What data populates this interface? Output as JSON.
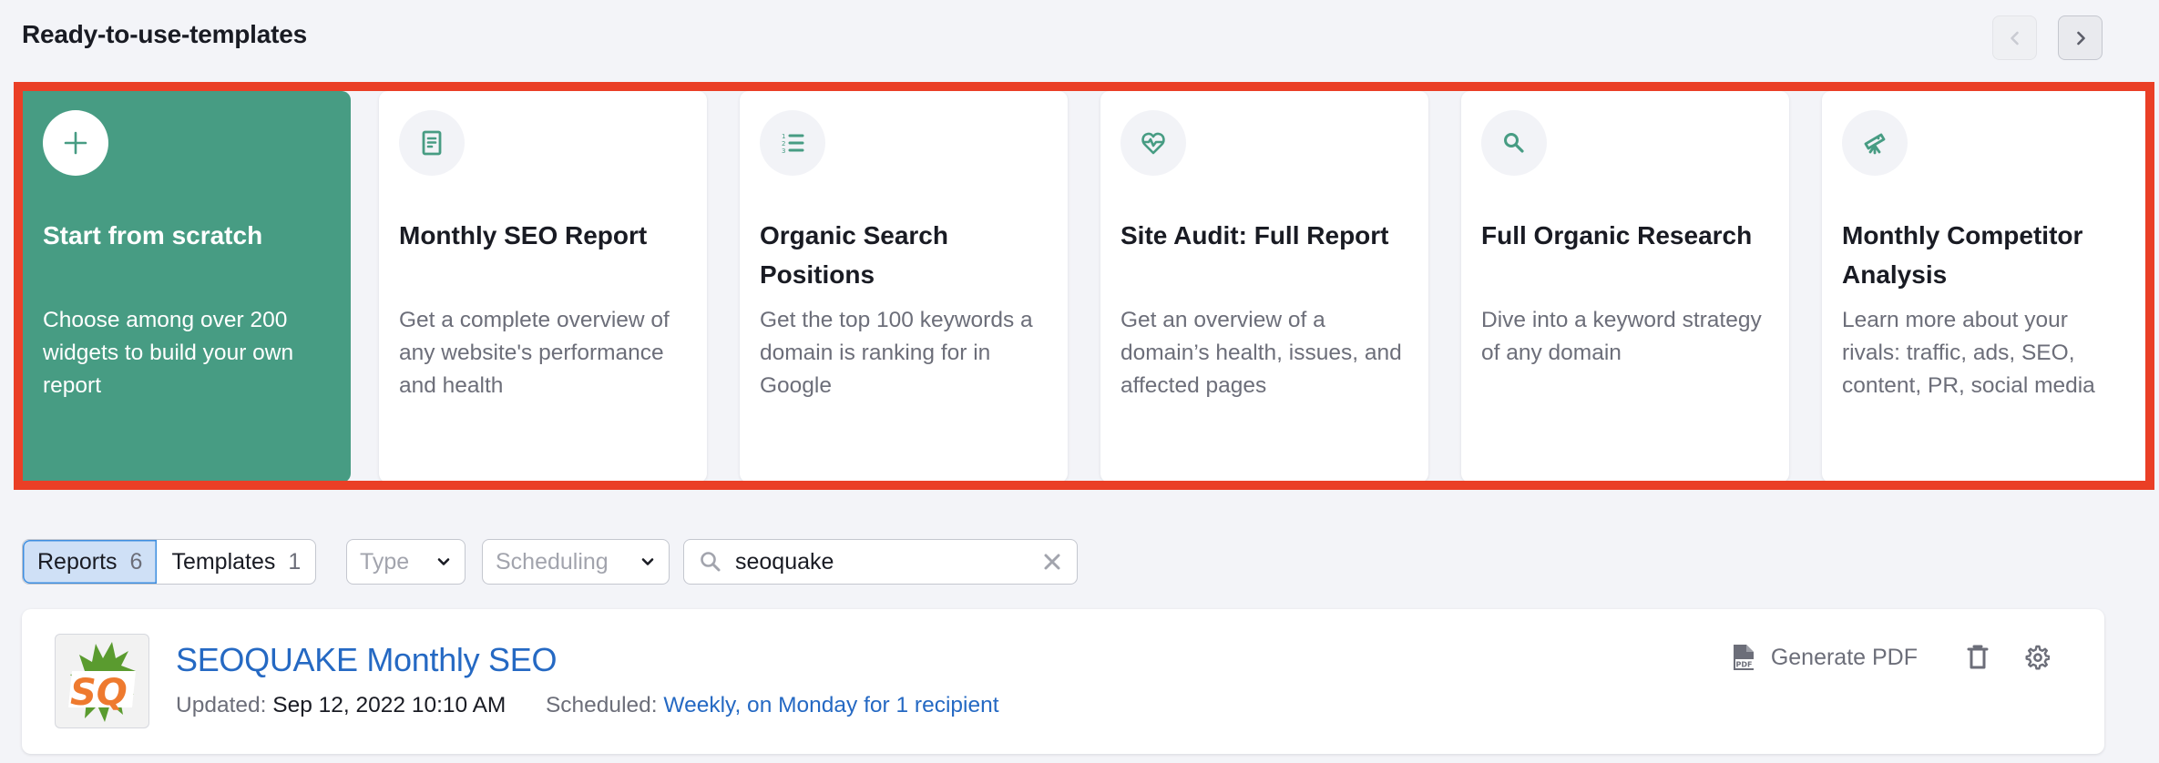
{
  "section": {
    "title": "Ready-to-use-templates",
    "nav": {
      "prev_icon": "chevron-left-icon",
      "next_icon": "chevron-right-icon",
      "prev_disabled": true
    }
  },
  "colors": {
    "accent_green": "#479c83",
    "highlight_red": "#ea3f26",
    "link_blue": "#2569c3",
    "active_tab_bg": "#cfe0f6"
  },
  "templates": [
    {
      "icon": "plus-icon",
      "title": "Start from scratch",
      "description": "Choose among over 200 widgets to build your own report",
      "primary": true
    },
    {
      "icon": "document-icon",
      "title": "Monthly SEO Report",
      "description": "Get a complete overview of any website's performance and health"
    },
    {
      "icon": "numbered-list-icon",
      "title": "Organic Search Positions",
      "description": "Get the top 100 keywords a domain is ranking for in Google"
    },
    {
      "icon": "heart-pulse-icon",
      "title": "Site Audit: Full Report",
      "description": "Get an overview of a domain’s health, issues, and affected pages"
    },
    {
      "icon": "magnifier-icon",
      "title": "Full Organic Research",
      "description": "Dive into a keyword strategy of any domain"
    },
    {
      "icon": "telescope-icon",
      "title": "Monthly Competitor Analysis",
      "description": "Learn more about your rivals: traffic, ads, SEO, content, PR, social media"
    }
  ],
  "filters": {
    "tabs": [
      {
        "label": "Reports",
        "count": "6",
        "active": true
      },
      {
        "label": "Templates",
        "count": "1",
        "active": false
      }
    ],
    "type_dropdown": {
      "placeholder": "Type"
    },
    "scheduling_dropdown": {
      "placeholder": "Scheduling"
    },
    "search": {
      "value": "seoquake",
      "placeholder": ""
    }
  },
  "reports": [
    {
      "logo_text": "SQ",
      "title": "SEOQUAKE Monthly SEO",
      "updated_label": "Updated:",
      "updated_value": "Sep 12, 2022 10:10 AM",
      "scheduled_label": "Scheduled:",
      "scheduled_value": "Weekly, on Monday for 1 recipient",
      "actions": {
        "generate_pdf": "Generate PDF"
      }
    }
  ]
}
